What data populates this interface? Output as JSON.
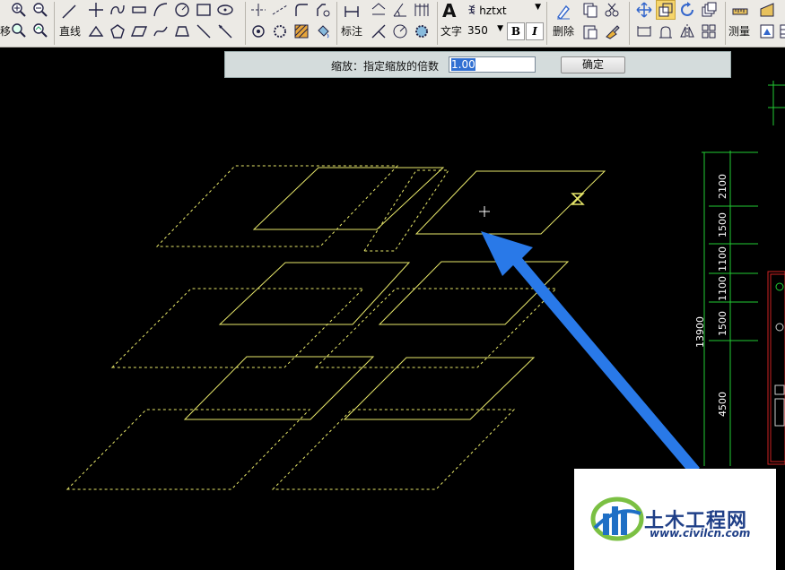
{
  "toolbar": {
    "left_partial_label": "移",
    "line_label": "直线",
    "dimension_label": "标注",
    "text_label": "文字",
    "delete_label": "删除",
    "measure_label": "测量",
    "font_name": "hztxt",
    "font_size": "350",
    "bold_label": "B",
    "italic_label": "I",
    "text_icon": "A"
  },
  "command_bar": {
    "prompt": "缩放：指定缩放的倍数",
    "value": "1.00",
    "ok_label": "确定"
  },
  "dimensions": [
    "2100",
    "1500",
    "1100",
    "1100",
    "1500",
    "13900",
    "4500"
  ],
  "watermark": {
    "title": "土木工程网",
    "url": "www.civilcn.com"
  },
  "colors": {
    "drawing_line": "#e8e86a",
    "dim_line": "#22cc33",
    "arrow": "#2979e8",
    "background": "#000000",
    "frame": "#cc2222"
  }
}
